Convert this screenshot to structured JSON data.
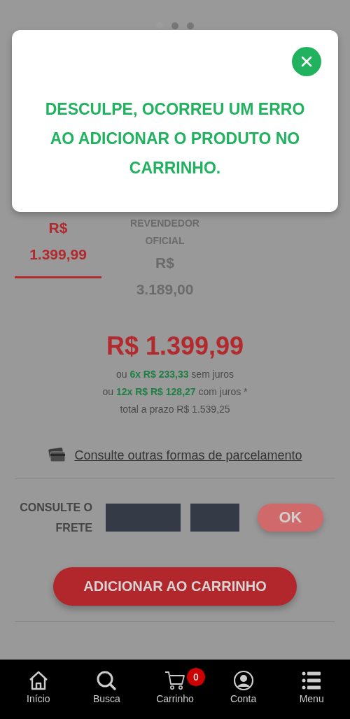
{
  "carousel_dots": [
    {
      "selected": true
    },
    {
      "selected": false
    },
    {
      "selected": false
    }
  ],
  "dialog": {
    "message": "DESCULPE, OCORREU UM ERRO AO ADICIONAR O PRODUTO NO CARRINHO."
  },
  "price_tabs": [
    {
      "lines": [
        "R$",
        "1.399,99"
      ],
      "selected": true
    },
    {
      "caption": "REVENDEDOR OFICIAL",
      "lines": [
        "R$",
        "3.189,00"
      ],
      "selected": false
    }
  ],
  "price": "R$ 1.399,99",
  "installments": [
    "ou **6x R$ 233,33** sem juros",
    "ou **12x R$ R$ 128,27** com juros *",
    "total a prazo R$ 1.539,25"
  ],
  "payment_link": "Consulte outras formas de parcelamento",
  "shipping": {
    "label": "CONSULTE O FRETE",
    "button": "OK"
  },
  "add_to_cart": "ADICIONAR AO CARRINHO",
  "bottom_nav": [
    {
      "kind": "home",
      "label": "Início"
    },
    {
      "kind": "search",
      "label": "Busca"
    },
    {
      "kind": "cart",
      "label": "Carrinho",
      "badge": "0"
    },
    {
      "kind": "account",
      "label": "Conta"
    },
    {
      "kind": "menu",
      "label": "Menu"
    }
  ]
}
